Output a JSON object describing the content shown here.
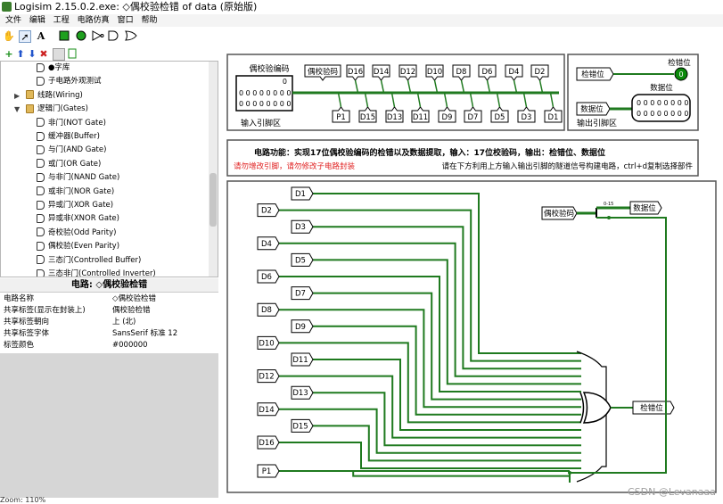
{
  "window": {
    "title": "Logisim 2.15.0.2.exe: ◇偶校验检错 of data (原始版)"
  },
  "menu": [
    "文件",
    "编辑",
    "工程",
    "电路仿真",
    "窗口",
    "帮助"
  ],
  "explorer": {
    "items": [
      {
        "label": "●字库",
        "indent": 2
      },
      {
        "label": "子电路外观测试",
        "indent": 2
      },
      {
        "label": "线路(Wiring)",
        "indent": 1,
        "folder": true,
        "expander": "▶"
      },
      {
        "label": "逻辑门(Gates)",
        "indent": 1,
        "folder": true,
        "expander": "▼"
      },
      {
        "label": "非门(NOT Gate)",
        "indent": 2
      },
      {
        "label": "缓冲器(Buffer)",
        "indent": 2
      },
      {
        "label": "与门(AND Gate)",
        "indent": 2
      },
      {
        "label": "或门(OR Gate)",
        "indent": 2
      },
      {
        "label": "与非门(NAND Gate)",
        "indent": 2
      },
      {
        "label": "或非门(NOR Gate)",
        "indent": 2
      },
      {
        "label": "异或门(XOR Gate)",
        "indent": 2
      },
      {
        "label": "异或非(XNOR Gate)",
        "indent": 2
      },
      {
        "label": "奇校验(Odd Parity)",
        "indent": 2
      },
      {
        "label": "偶校验(Even Parity)",
        "indent": 2
      },
      {
        "label": "三态门(Controlled Buffer)",
        "indent": 2
      },
      {
        "label": "三态非门(Controlled Inverter)",
        "indent": 2
      }
    ]
  },
  "props": {
    "header": "电路: ◇偶校验检错",
    "rows": [
      {
        "k": "电路名称",
        "v": "◇偶校验检错"
      },
      {
        "k": "共享标签(显示在封装上)",
        "v": "偶校验检错"
      },
      {
        "k": "共享标签朝向",
        "v": "上 (北)"
      },
      {
        "k": "共享标签字体",
        "v": "SansSerif 标准 12"
      },
      {
        "k": "标签颜色",
        "v": "#000000"
      }
    ]
  },
  "status": {
    "zoom": "Zoom: 110%"
  },
  "watermark": "CSDN @Levanaaa",
  "circuit": {
    "input_area": {
      "label": "输入引脚区",
      "pin_label": "偶校验编码",
      "bits_row1_prefix": "0",
      "bits_row2": "0 0 0 0 0 0 0 0",
      "bits_row3": "0 0 0 0 0 0 0 0",
      "tunnel_top": [
        "偶校验码",
        "D16",
        "D14",
        "D12",
        "D10",
        "D8",
        "D6",
        "D4",
        "D2"
      ],
      "tunnel_bottom": [
        "P1",
        "D15",
        "D13",
        "D11",
        "D9",
        "D7",
        "D5",
        "D3",
        "D1"
      ]
    },
    "output_area": {
      "label": "输出引脚区",
      "err_in": "检错位",
      "err_pin_label": "检错位",
      "err_value": "0",
      "data_in": "数据位",
      "data_pin_label": "数据位",
      "data_bits_1": "0 0 0 0 0 0 0 0",
      "data_bits_2": "0 0 0 0 0 0 0 0"
    },
    "info": {
      "function": "电路功能：实现17位偶校验编码的检错以及数据提取，输入：17位校验码，输出：检错位、数据位",
      "warning": "请勿增改引脚，请勿修改子电路封装",
      "hint": "请在下方利用上方输入输出引脚的隧道信号构建电路，ctrl+d复制选择部件"
    },
    "main": {
      "left_tunnels": [
        "D1",
        "D2",
        "D3",
        "D4",
        "D5",
        "D6",
        "D7",
        "D8",
        "D9",
        "D10",
        "D11",
        "D12",
        "D13",
        "D14",
        "D15",
        "D16",
        "P1"
      ],
      "splitter_in": "偶校验码",
      "data_out": "数据位",
      "err_out": "检错位"
    },
    "colors": {
      "wire": "#1f7a1f",
      "led": "#0b8a0b"
    }
  }
}
